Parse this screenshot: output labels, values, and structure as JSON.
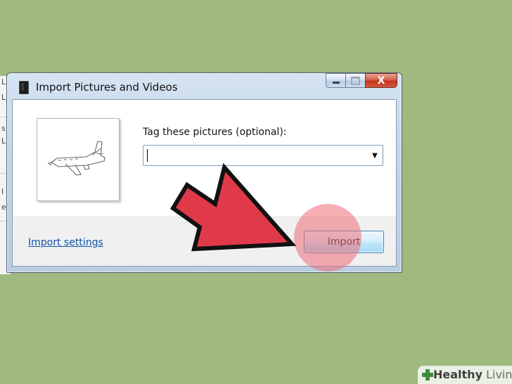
{
  "window": {
    "title": "Import Pictures and Videos",
    "icon": "camera-device-icon"
  },
  "caption_buttons": {
    "minimize": "minimize-icon",
    "maximize": "maximize-icon",
    "close": "X"
  },
  "content": {
    "thumbnail": "airplane-sketch-image",
    "tag_label": "Tag these pictures (optional):",
    "tag_value": "",
    "tag_placeholder": ""
  },
  "footer": {
    "import_settings_label": "Import settings",
    "import_button_label": "Import"
  },
  "background_window": {
    "visible_letters": [
      "L",
      "L",
      "s",
      "L",
      "I",
      "e"
    ]
  },
  "watermark": {
    "brand_bold": "Healthy",
    "brand_light": " Living"
  },
  "colors": {
    "background": "#9fb97e",
    "arrow": "#e03a4a",
    "click_highlight": "#ec6e78",
    "link": "#0e52a8",
    "button_border": "#3c7fb1",
    "close_button": "#c2341d"
  }
}
